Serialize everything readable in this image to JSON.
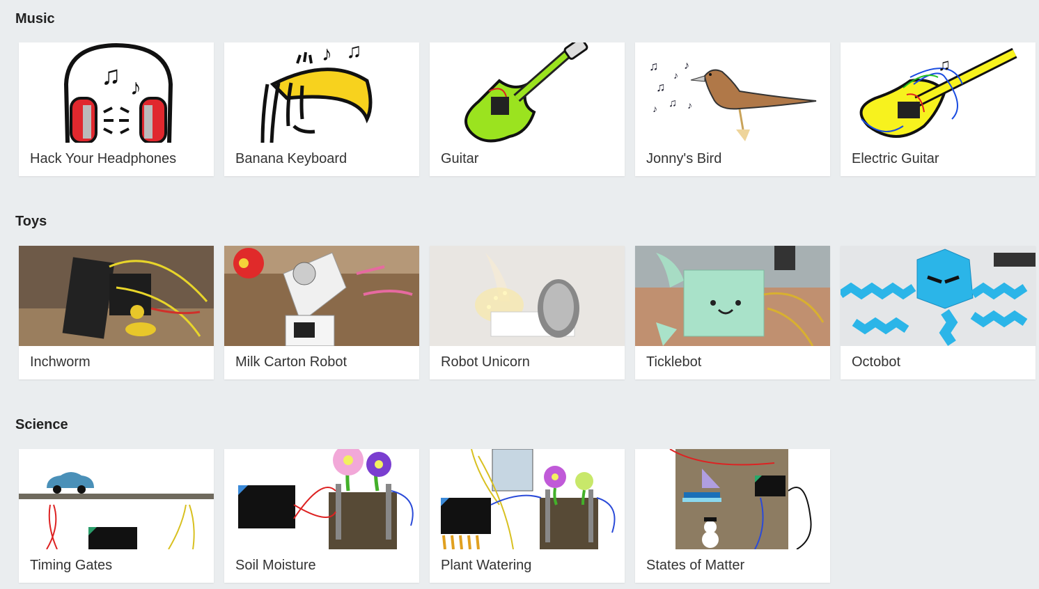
{
  "sections": [
    {
      "title": "Music",
      "cards": [
        {
          "label": "Hack Your Headphones",
          "image": "headphones-illustration"
        },
        {
          "label": "Banana Keyboard",
          "image": "banana-keyboard-illustration"
        },
        {
          "label": "Guitar",
          "image": "guitar-illustration"
        },
        {
          "label": "Jonny's Bird",
          "image": "bird-illustration"
        },
        {
          "label": "Electric Guitar",
          "image": "electric-guitar-illustration"
        }
      ]
    },
    {
      "title": "Toys",
      "cards": [
        {
          "label": "Inchworm",
          "image": "inchworm-photo"
        },
        {
          "label": "Milk Carton Robot",
          "image": "milk-carton-robot-photo"
        },
        {
          "label": "Robot Unicorn",
          "image": "robot-unicorn-photo"
        },
        {
          "label": "Ticklebot",
          "image": "ticklebot-photo"
        },
        {
          "label": "Octobot",
          "image": "octobot-photo"
        }
      ]
    },
    {
      "title": "Science",
      "cards": [
        {
          "label": "Timing Gates",
          "image": "timing-gates-illustration"
        },
        {
          "label": "Soil Moisture",
          "image": "soil-moisture-illustration"
        },
        {
          "label": "Plant Watering",
          "image": "plant-watering-illustration"
        },
        {
          "label": "States of Matter",
          "image": "states-of-matter-illustration"
        }
      ]
    }
  ],
  "colors": {
    "page_background": "#eaedef",
    "card_background": "#ffffff",
    "text": "#333333"
  }
}
